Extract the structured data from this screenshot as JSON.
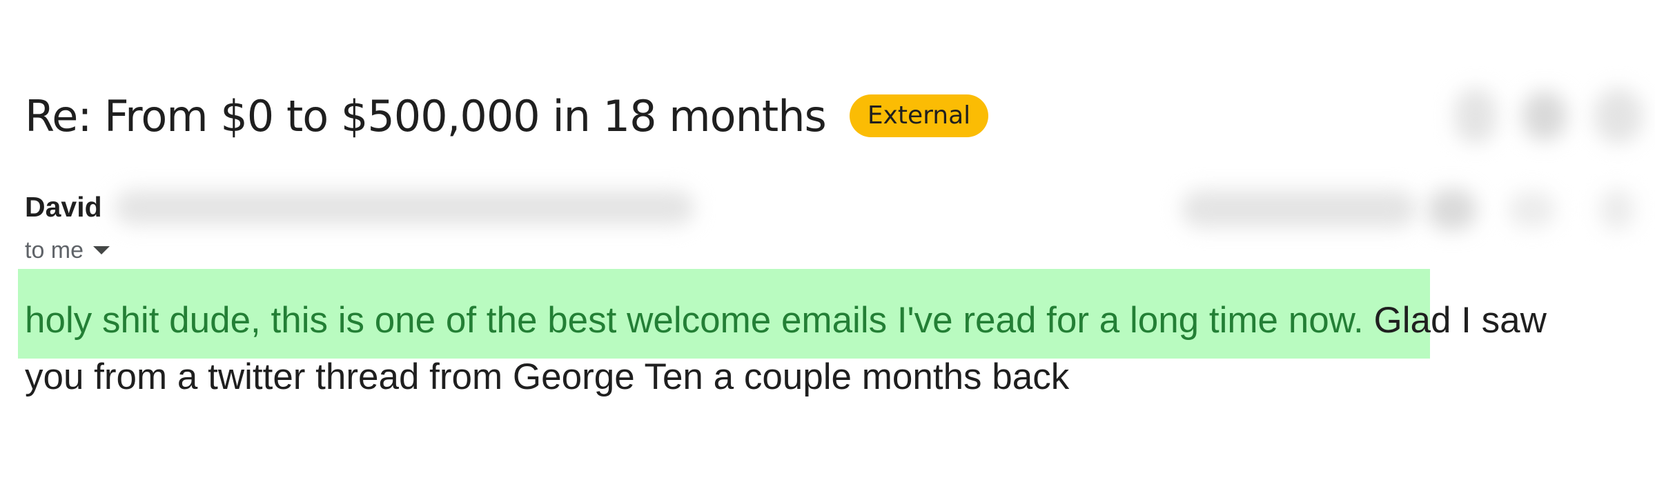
{
  "email": {
    "subject": "Re: From $0 to $500,000 in 18 months",
    "external_badge": "External",
    "sender_name": "David",
    "recipient": "to me",
    "body": {
      "highlighted_text": "holy shit dude, this is one of the best welcome emails I've read for a long time now.",
      "line1_rest": " Glad I saw",
      "line2": "you from a twitter thread from George Ten a couple months back"
    }
  },
  "colors": {
    "badge_bg": "#fbbc04",
    "highlight_bg": "#b9fbc0",
    "highlight_text": "#237f35"
  },
  "icons": {
    "recipient_toggle": "caret-down-icon"
  }
}
